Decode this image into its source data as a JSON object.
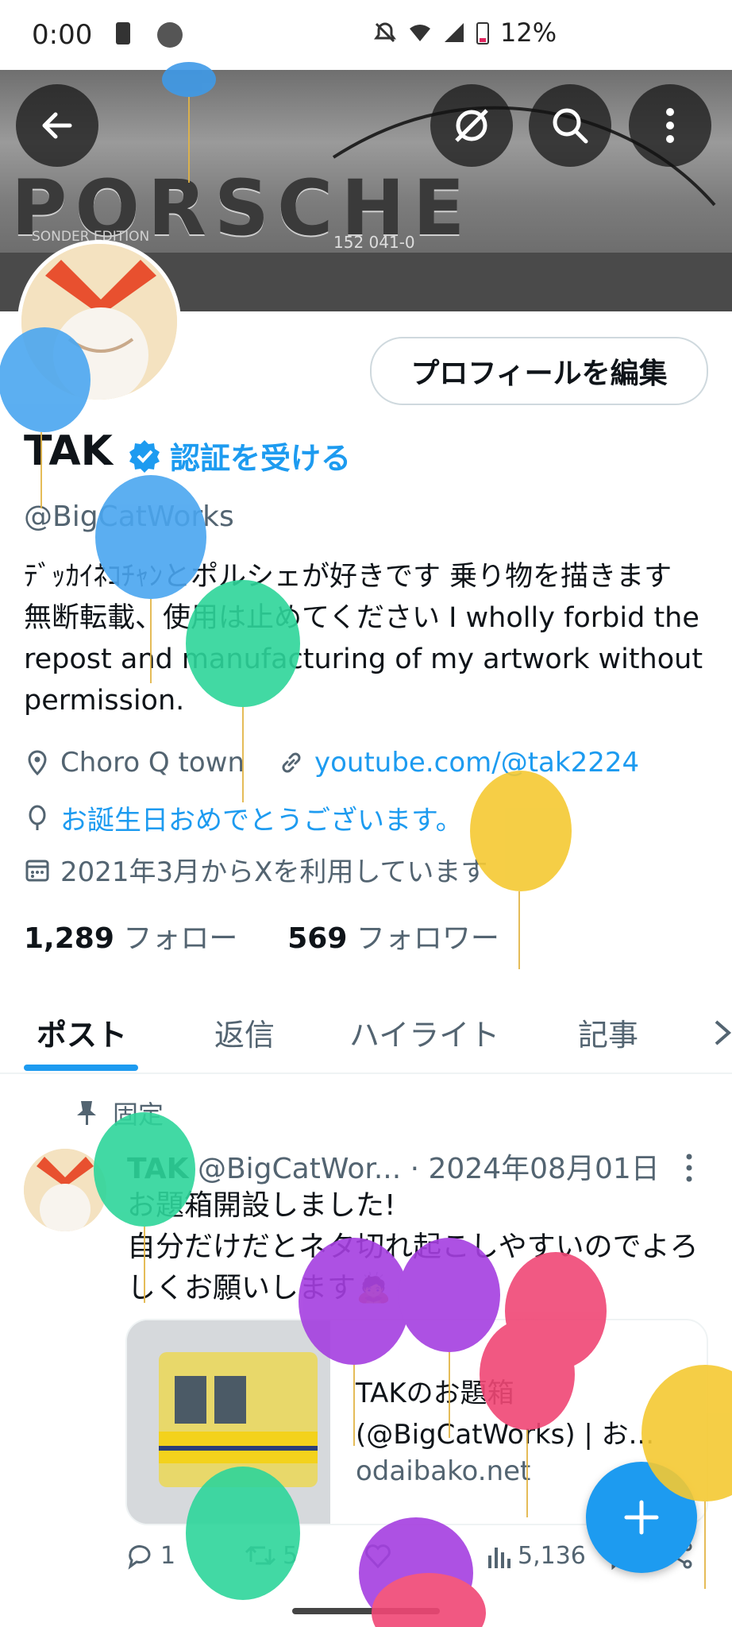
{
  "status_bar": {
    "time": "0:00",
    "battery": "12%"
  },
  "banner": {
    "wordmark": "PORSCHE",
    "plate_left": "SONDER EDITION",
    "plate_number": "152 041-0"
  },
  "profile": {
    "edit_label": "プロフィールを編集",
    "name": "TAK",
    "verify_label": "認証を受ける",
    "handle": "@BigCatWorks",
    "bio": "ﾃﾞｯｶｲﾈｺﾁｬﾝとポルシェが好きです 乗り物を描きます 無断転載、使用は止めてください I wholly forbid the repost and manufacturing of my artwork without permission.",
    "location": "Choro Q town",
    "website": "youtube.com/@tak2224",
    "birthday": "お誕生日おめでとうございます。",
    "joined": "2021年3月からXを利用しています",
    "following_count": "1,289",
    "following_label": "フォロー",
    "followers_count": "569",
    "followers_label": "フォロワー"
  },
  "tabs": [
    {
      "label": "ポスト",
      "active": true
    },
    {
      "label": "返信"
    },
    {
      "label": "ハイライト"
    },
    {
      "label": "記事"
    }
  ],
  "post": {
    "pinned_label": "固定",
    "author": "TAK",
    "handle_date": "@BigCatWor... · 2024年08月01日",
    "line1": "お題箱開設しました!",
    "line2": "自分だけだとネタ切れ起こしやすいのでよろしくお願いします🙇",
    "card_title1": "TAKのお題箱",
    "card_title2": "(@BigCatWorks) | お...",
    "card_domain": "odaibako.net",
    "replies": "1",
    "reposts": "5",
    "views": "5,136"
  },
  "colors": {
    "accent": "#1d9bf0",
    "text": "#0f1419",
    "muted": "#536471"
  }
}
